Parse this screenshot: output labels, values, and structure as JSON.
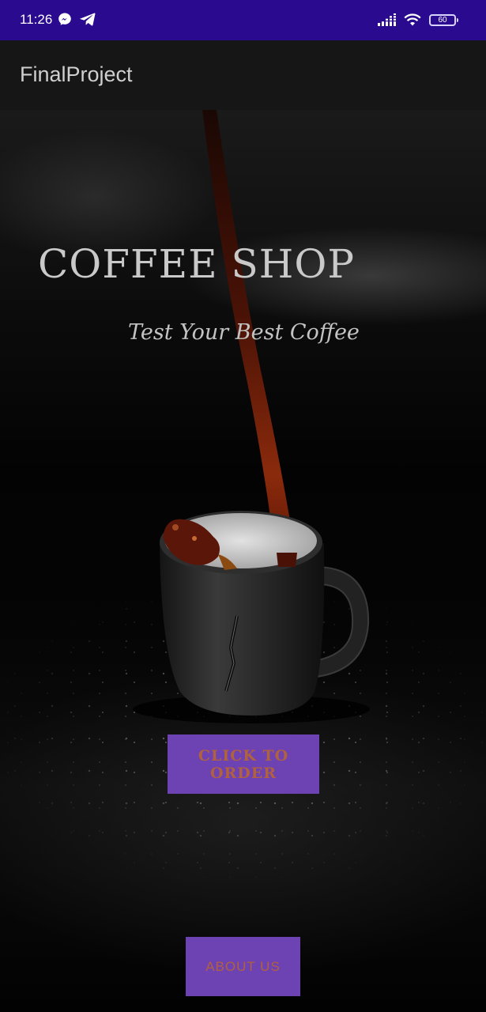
{
  "status_bar": {
    "time": "11:26",
    "battery_level": "60",
    "background_color": "#2a0a8e",
    "icons": [
      "messenger-icon",
      "telegram-icon",
      "signal-icon",
      "wifi-icon",
      "battery-icon"
    ]
  },
  "app_bar": {
    "title": "FinalProject",
    "background_color": "#161616"
  },
  "hero": {
    "headline": "COFFEE SHOP",
    "tagline": "Test Your Best Coffee",
    "image": "coffee-pour-into-cup-photo"
  },
  "actions": {
    "order_label": "CLICK TO ORDER",
    "about_label": "ABOUT US",
    "button_color": "#6d42b3",
    "button_text_color": "#b0623e"
  }
}
